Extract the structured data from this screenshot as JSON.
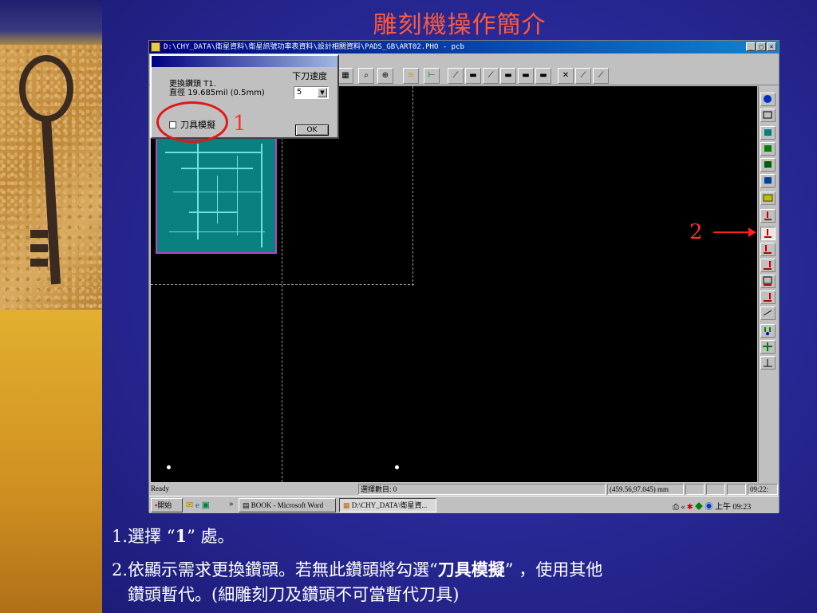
{
  "slide": {
    "title": "雕刻機操作簡介",
    "annotations": {
      "mark1": "1",
      "mark2": "2"
    }
  },
  "window": {
    "title": "D:\\CHY_DATA\\衛星資料\\衛星訊號功率表資料\\設計相關資料\\PADS_GB\\ART02.PHO - pcb",
    "buttons": [
      "_",
      "□",
      "×"
    ]
  },
  "dialog": {
    "line1": "更換鑽頭 T1.",
    "line2": "直徑 19.685mil (0.5mm)",
    "speed_label": "下刀速度",
    "speed_value": "5",
    "checkbox_label": "刀具模擬",
    "ok_label": "OK"
  },
  "statusbar": {
    "ready": "Ready",
    "selection": "選擇數目: 0",
    "coords": "(459.56,97.045) mm",
    "time": "09:22:"
  },
  "taskbar": {
    "start": "開始",
    "chevron": "»",
    "task1": "BOOK - Microsoft Word",
    "task2": "D:\\CHY_DATA\\衛星資...",
    "chevron_tray": "«",
    "clock": "上午 09:23"
  },
  "caption": {
    "l1_a": "1.選擇 “",
    "l1_b": "1",
    "l1_c": "” 處。",
    "l2_a": "2.依顯示需求更換鑽頭。若無此鑽頭將勾選“",
    "l2_b": "刀具模擬",
    "l2_c": "” ，使用其他",
    "l3": "鑽頭暫代。(細雕刻刀及鑽頭不可當暫代刀具)"
  },
  "colors": {
    "accent_red": "#e01818",
    "title_color": "#ff5a3a",
    "canvas": "#000000",
    "pcb": "#0a8080"
  }
}
